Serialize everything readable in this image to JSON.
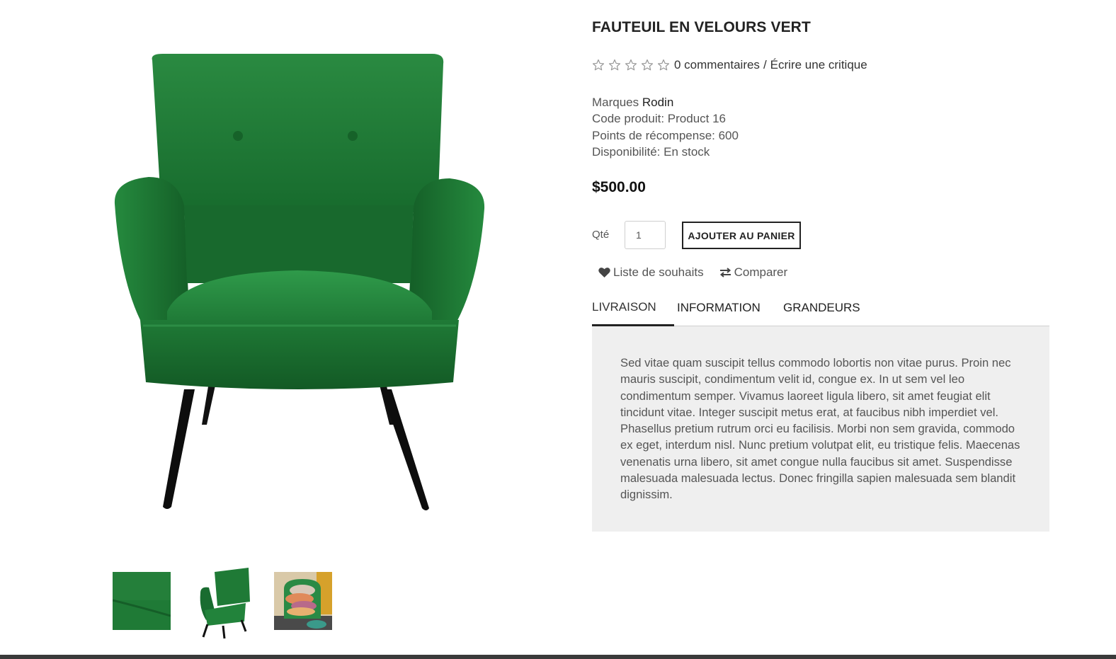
{
  "product": {
    "title": "FAUTEUIL EN VELOURS VERT",
    "reviews_link": "0 commentaires",
    "review_separator": "/",
    "write_review_link": "Écrire une critique",
    "rating": 0,
    "rating_max": 5,
    "brand_label": "Marques",
    "brand_value": "Rodin",
    "code_line": "Code produit: Product 16",
    "reward_line": "Points de récompense: 600",
    "availability_line": "Disponibilité: En stock",
    "price": "$500.00"
  },
  "purchase": {
    "qty_label": "Qté",
    "qty_value": "1",
    "add_to_cart_label": "AJOUTER AU PANIER"
  },
  "actions": {
    "wishlist_label": "Liste de souhaits",
    "compare_label": "Comparer"
  },
  "tabs": [
    {
      "label": "LIVRAISON",
      "active": true
    },
    {
      "label": "INFORMATION",
      "active": false
    },
    {
      "label": "GRANDEURS",
      "active": false
    }
  ],
  "tab_content": "Sed vitae quam suscipit tellus commodo lobortis non vitae purus. Proin nec mauris suscipit, condimentum velit id, congue ex. In ut sem vel leo condimentum semper. Vivamus laoreet ligula libero, sit amet feugiat elit tincidunt vitae. Integer suscipit metus erat, at faucibus nibh imperdiet vel. Phasellus pretium rutrum orci eu facilisis. Morbi non sem gravida, commodo ex eget, interdum nisl. Nunc pretium volutpat elit, eu tristique felis. Maecenas venenatis urna libero, sit amet congue nulla faucibus sit amet. Suspendisse malesuada malesuada lectus. Donec fringilla sapien malesuada sem blandit dignissim.",
  "icons": {
    "rating_star": "star-outline-icon",
    "wishlist": "heart-icon",
    "compare": "exchange-arrows-icon"
  },
  "colors": {
    "velvet_green": "#1f7a36",
    "text_dark": "#222222",
    "panel_bg": "#efefef"
  }
}
